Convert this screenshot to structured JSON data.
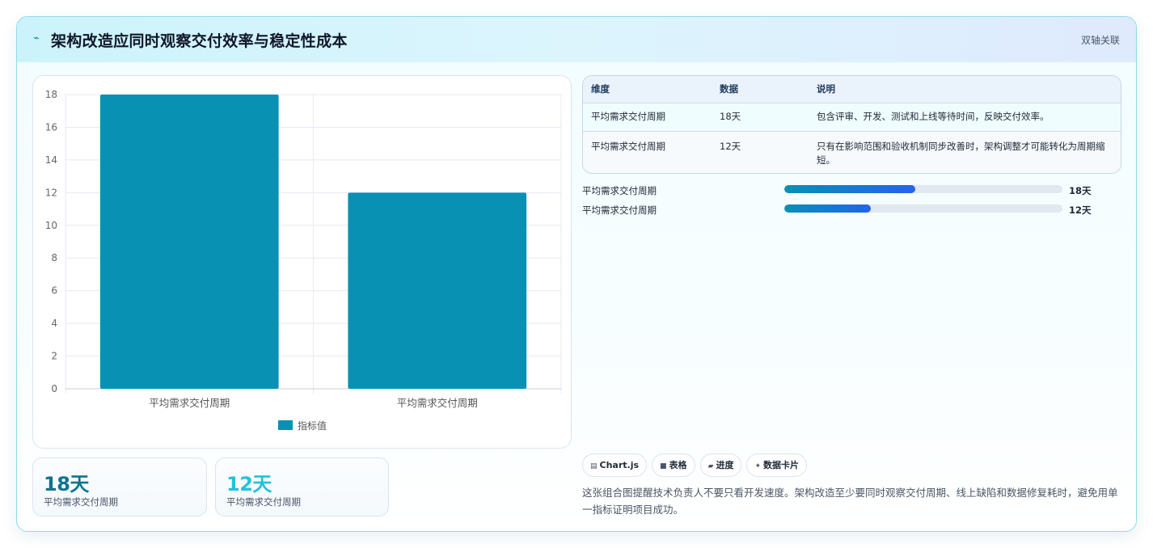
{
  "header": {
    "icon": "trend-icon",
    "title": "架构改造应同时观察交付效率与稳定性成本",
    "tag": "双轴关联"
  },
  "chart_data": {
    "type": "bar",
    "categories": [
      "平均需求交付周期",
      "平均需求交付周期"
    ],
    "series": [
      {
        "name": "指标值",
        "values": [
          18,
          12
        ],
        "color": "#0891b2"
      }
    ],
    "ylim": [
      0,
      18
    ],
    "yticks": [
      0,
      2,
      4,
      6,
      8,
      10,
      12,
      14,
      16,
      18
    ],
    "grid": true,
    "legend": "bottom"
  },
  "kpis": [
    {
      "value": "18天",
      "label": "平均需求交付周期",
      "color": "#0e7490"
    },
    {
      "value": "12天",
      "label": "平均需求交付周期",
      "color": "#22c3da"
    }
  ],
  "table": {
    "headers": [
      "维度",
      "数据",
      "说明"
    ],
    "rows": [
      {
        "dim": "平均需求交付周期",
        "data": "18天",
        "desc": "包含评审、开发、测试和上线等待时间，反映交付效率。"
      },
      {
        "dim": "平均需求交付周期",
        "data": "12天",
        "desc": "只有在影响范围和验收机制同步改善时，架构调整才可能转化为周期缩短。"
      }
    ]
  },
  "progress": [
    {
      "label": "平均需求交付周期",
      "value": "18天",
      "fraction": 0.47
    },
    {
      "label": "平均需求交付周期",
      "value": "12天",
      "fraction": 0.31
    }
  ],
  "tags": [
    {
      "icon": "chart-icon",
      "glyph": "▤",
      "label": "Chart.js"
    },
    {
      "icon": "table-icon",
      "glyph": "■",
      "label": "表格"
    },
    {
      "icon": "progress-icon",
      "glyph": "▰",
      "label": "进度"
    },
    {
      "icon": "sparkle-icon",
      "glyph": "✦",
      "label": "数据卡片"
    }
  ],
  "summary": "这张组合图提醒技术负责人不要只看开发速度。架构改造至少要同时观察交付周期、线上缺陷和数据修复耗时，避免用单一指标证明项目成功。"
}
